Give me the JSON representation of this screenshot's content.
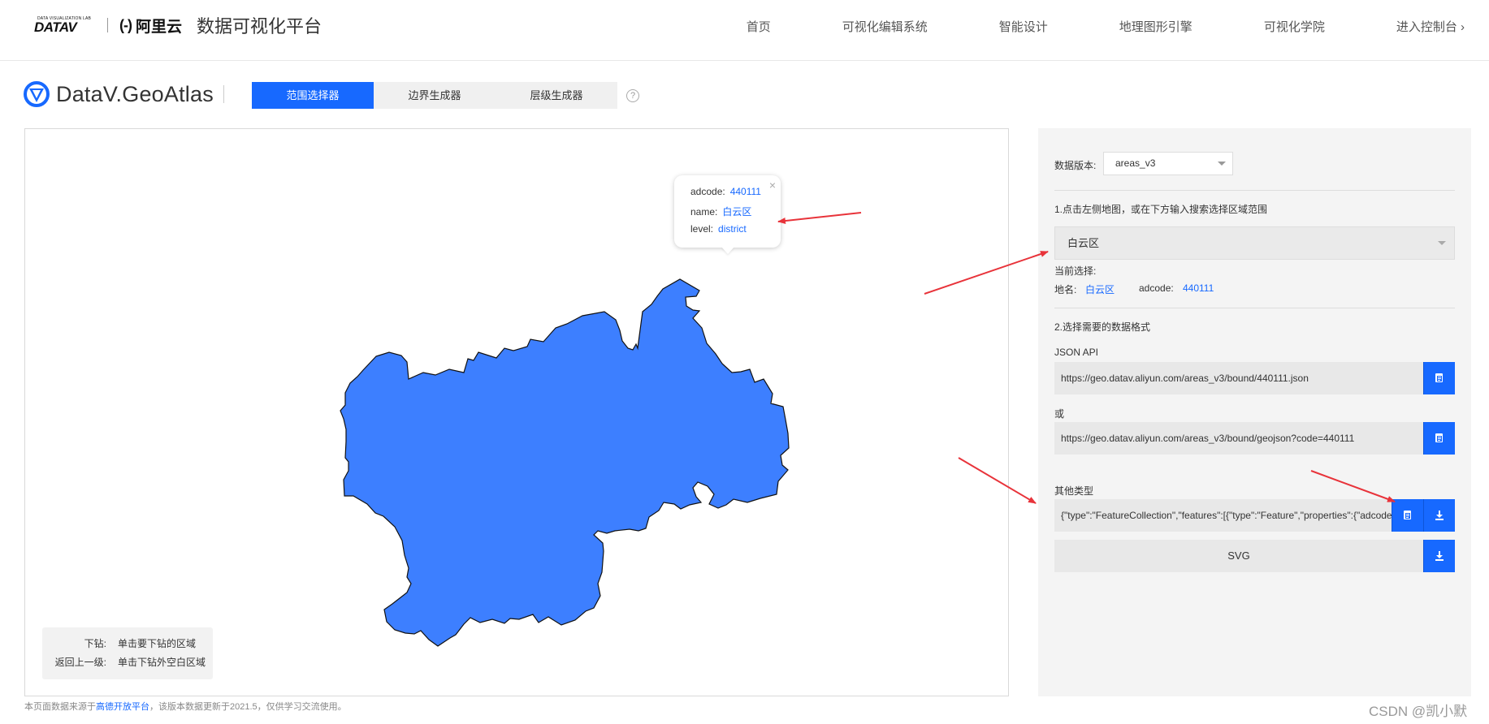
{
  "header": {
    "datav_tagline": "DATA VISUALIZATION LAB",
    "datav_logo": "DATAV",
    "aliyun_mark": "(-)",
    "aliyun_logo": "阿里云",
    "platform_title": "数据可视化平台",
    "nav": [
      "首页",
      "可视化编辑系统",
      "智能设计",
      "地理图形引擎",
      "可视化学院",
      "进入控制台 ›"
    ]
  },
  "subheader": {
    "product_name": "DataV.GeoAtlas",
    "tabs": [
      "范围选择器",
      "边界生成器",
      "层级生成器"
    ],
    "active_tab": "范围选择器",
    "help_icon": "?"
  },
  "map": {
    "region_color": "#3d7fff",
    "popup": {
      "adcode_label": "adcode:",
      "adcode_value": "440111",
      "name_label": "name:",
      "name_value": "白云区",
      "level_label": "level:",
      "level_value": "district",
      "close_icon": "×"
    },
    "legend": [
      {
        "key": "下钻:",
        "value": "单击要下钻的区域"
      },
      {
        "key": "返回上一级:",
        "value": "单击下钻外空白区域"
      }
    ]
  },
  "footnote": {
    "prefix": "本页面数据来源于",
    "link": "高德开放平台",
    "suffix": "，该版本数据更新于2021.5，仅供学习交流使用。"
  },
  "watermark": "CSDN @凯小默",
  "right_panel": {
    "data_version_label": "数据版本:",
    "data_version_value": "areas_v3",
    "step1": "1.点击左侧地图，或在下方输入搜索选择区域范围",
    "region_select_value": "白云区",
    "current_selection_label": "当前选择:",
    "place_name_label": "地名:",
    "place_name_value": "白云区",
    "adcode_label": "adcode:",
    "adcode_value": "440111",
    "step2": "2.选择需要的数据格式",
    "json_api_label": "JSON API",
    "json_api_url": "https://geo.datav.aliyun.com/areas_v3/bound/440111.json",
    "or_label": "或",
    "geojson_url": "https://geo.datav.aliyun.com/areas_v3/bound/geojson?code=440111",
    "other_types_label": "其他类型",
    "other_types_value": "{\"type\":\"FeatureCollection\",\"features\":[{\"type\":\"Feature\",\"properties\":{\"adcode\"",
    "svg_label": "SVG",
    "accent_color": "#1769ff"
  }
}
